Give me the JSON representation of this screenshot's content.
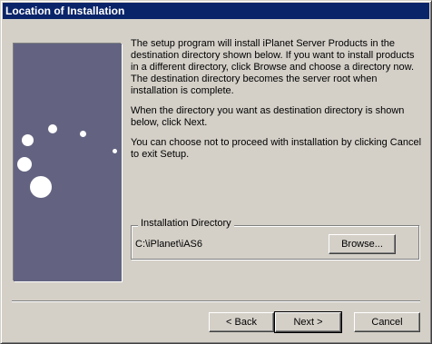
{
  "window": {
    "title": "Location of Installation"
  },
  "description": {
    "para1": "The setup program will install iPlanet Server Products in the destination directory shown below. If you want to install products in a different directory, click Browse and choose a directory now. The destination directory becomes the server root when installation is complete.",
    "para2": "When the directory you want as destination directory is shown below, click Next.",
    "para3": "You can choose not to proceed with installation by clicking Cancel to exit Setup."
  },
  "install_dir": {
    "legend": "Installation Directory",
    "path": "C:\\iPlanet\\iAS6",
    "browse_label": "Browse..."
  },
  "buttons": {
    "back_label": "< Back",
    "next_label": "Next >",
    "cancel_label": "Cancel"
  }
}
